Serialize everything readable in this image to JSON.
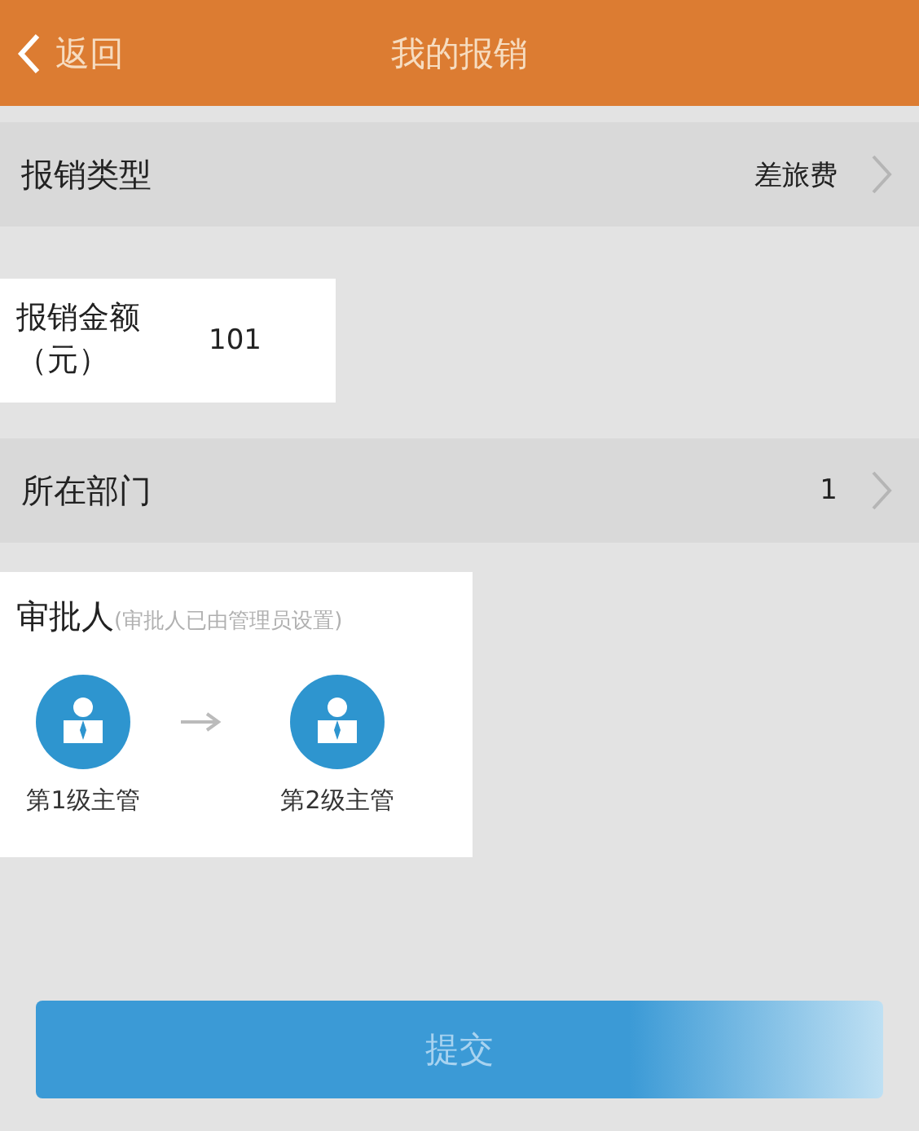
{
  "header": {
    "back": "返回",
    "title": "我的报销"
  },
  "type_row": {
    "label": "报销类型",
    "value": "差旅费"
  },
  "amount": {
    "label": "报销金额（元）",
    "value": "101"
  },
  "dept_row": {
    "label": "所在部门",
    "value": "1"
  },
  "approvers": {
    "title": "审批人",
    "hint": "(审批人已由管理员设置)",
    "steps": [
      {
        "label": "第1级主管"
      },
      {
        "label": "第2级主管"
      }
    ]
  },
  "submit": "提交"
}
